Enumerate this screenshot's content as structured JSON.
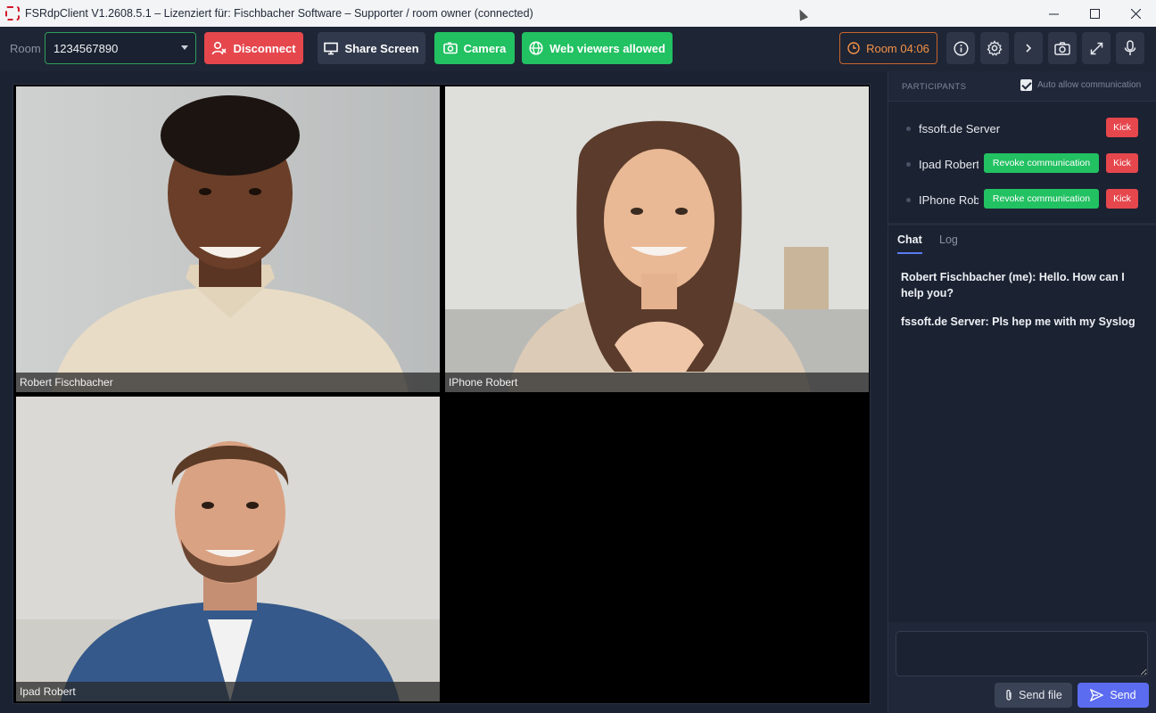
{
  "window": {
    "title": "FSRdpClient V1.2608.5.1 – Lizenziert für: Fischbacher Software – Supporter / room owner (connected)",
    "controls": [
      "minimize",
      "maximize",
      "close"
    ]
  },
  "toolbar": {
    "room_label": "Room",
    "room_value": "1234567890",
    "disconnect_label": "Disconnect",
    "share_label": "Share Screen",
    "camera_label": "Camera",
    "web_label": "Web viewers allowed",
    "timer_label": "Room 04:06",
    "icons": [
      "info-icon",
      "gear-icon",
      "chevron-right-icon",
      "snapshot-icon",
      "expand-icon",
      "microphone-icon"
    ]
  },
  "videos": [
    {
      "name": "Robert Fischbacher"
    },
    {
      "name": "IPhone Robert"
    },
    {
      "name": "Ipad Robert"
    }
  ],
  "participants": {
    "title": "PARTICIPANTS",
    "auto_allow_label": "Auto allow communication",
    "auto_allow_checked": true,
    "kick_label": "Kick",
    "revoke_label": "Revoke communication",
    "items": [
      {
        "name": "fssoft.de Server",
        "revoke": false
      },
      {
        "name": "Ipad Robert",
        "revoke": true
      },
      {
        "name": "IPhone Robert",
        "revoke": true
      }
    ]
  },
  "tabs": {
    "chat": "Chat",
    "log": "Log",
    "active": "Chat"
  },
  "chat": {
    "messages": [
      "Robert Fischbacher (me): Hello. How can I help you?",
      "fssoft.de Server: Pls hep me with my Syslog"
    ],
    "input_value": "",
    "send_file_label": "Send file",
    "send_label": "Send"
  },
  "colors": {
    "accent_green": "#22c162",
    "accent_red": "#e5474d",
    "accent_blue": "#5b6cf0",
    "timer_orange": "#f59346"
  }
}
